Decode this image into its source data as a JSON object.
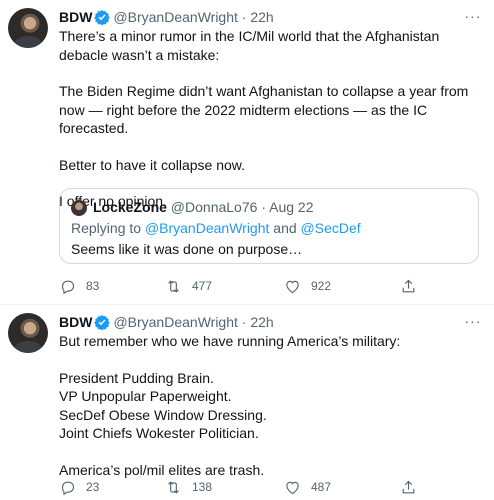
{
  "tweets": [
    {
      "author": {
        "name": "BDW",
        "handle": "@BryanDeanWright",
        "separator": "·",
        "time": "22h"
      },
      "paragraphs": [
        "There’s a minor rumor in the IC/Mil world that the Afghanistan debacle wasn’t a mistake:",
        "The Biden Regime didn’t want Afghanistan to collapse a year from now — right before the 2022 midterm elections — as the IC forecasted.",
        "Better to have it collapse now.",
        "I offer no opinion."
      ],
      "quote": {
        "name": "LockeZone",
        "handle": "@DonnaLo76",
        "separator": "·",
        "date": "Aug 22",
        "replying_prefix": "Replying to",
        "replying_to_1": "@BryanDeanWright",
        "replying_and": "and",
        "replying_to_2": "@SecDef",
        "text": "Seems like it was done on purpose…"
      },
      "actions": {
        "replies": "83",
        "retweets": "477",
        "likes": "922"
      }
    },
    {
      "author": {
        "name": "BDW",
        "handle": "@BryanDeanWright",
        "separator": "·",
        "time": "22h"
      },
      "line1": "But remember who we have running America’s military:",
      "list": [
        "President Pudding Brain.",
        "VP Unpopular Paperweight.",
        "SecDef Obese Window Dressing.",
        "Joint Chiefs Wokester Politician."
      ],
      "closing": "America’s pol/mil elites are trash.",
      "actions": {
        "replies": "23",
        "retweets": "138",
        "likes": "487"
      }
    }
  ],
  "icons": {
    "more": "more-dots-icon",
    "verified": "verified-badge-icon",
    "reply": "reply-bubble-icon",
    "retweet": "retweet-arrows-icon",
    "like": "heart-icon",
    "share": "share-upload-icon"
  },
  "colors": {
    "text": "#0f1419",
    "muted": "#536471",
    "link": "#1d9bf0",
    "verified": "#1d9bf0",
    "border": "#cfd9de"
  },
  "more_glyph": "···"
}
